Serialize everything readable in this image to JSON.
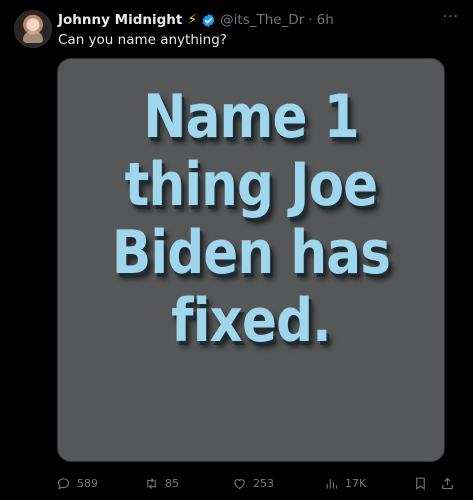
{
  "tweet": {
    "display_name": "Johnny Midnight",
    "name_emoji": "⚡",
    "handle": "@its_The_Dr",
    "separator": "·",
    "time": "6h",
    "more": "···",
    "text": "Can you name anything?",
    "media_text_lines": [
      "Name 1",
      "thing Joe",
      "Biden has",
      "fixed."
    ]
  },
  "actions": {
    "replies": "589",
    "reposts": "85",
    "likes": "253",
    "views": "17K"
  },
  "colors": {
    "background": "#000000",
    "verified": "#1d9bf0",
    "media_bg": "#565758",
    "media_text": "#9fd6ec",
    "muted": "#71767b"
  }
}
